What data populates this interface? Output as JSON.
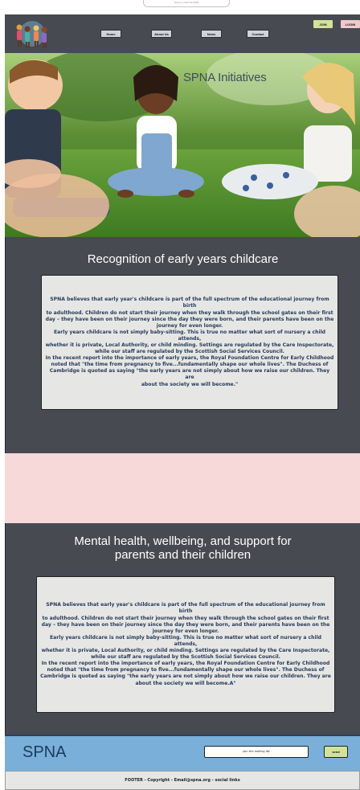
{
  "top_pill": "www.xx | April 22 2022",
  "nav": {
    "logo_icon": "children-logo-icon",
    "links": [
      "Home",
      "About Us",
      "News",
      "Contact"
    ],
    "join_label": "JOIN",
    "login_label": "LOGIN"
  },
  "hero": {
    "title": "SPNA Initiatives"
  },
  "section1": {
    "title": "Recognition of early years childcare",
    "body": "SPNA believes that early year's childcare is part of the full spectrum of the educational journey from birth\nto adulthood. Children do not start their journey when they walk through the school gates on their first\nday – they have been on their journey since the day they were born, and their parents have been on the\njourney for even longer.\nEarly years childcare is not simply baby-sitting. This is true no matter what sort of nursery a child attends,\nwhether it is private, Local Authority, or child minding. Settings are regulated by the Care Inspectorate,\nwhile our staff are regulated by the Scottish Social Services Council.\nIn the recent report into the importance of early years, the Royal Foundation Centre for Early Childhood\nnoted that \"the time from pregnancy to five...fundamentally shape our whole lives\". The Duchess of\nCambridge is quoted as saying \"the early years are not simply about how we raise our children. They are\nabout the society we will become.\""
  },
  "section2": {
    "title": "Mental health, wellbeing, and support for\nparents and their children",
    "body": "SPNA believes that early year's childcare is part of the full spectrum of the educational journey from birth\nto adulthood. Children do not start their journey when they walk through the school gates on their first\nday – they have been on their journey since the day they were born, and their parents have been on the\njourney for even longer.\nEarly years childcare is not simply baby-sitting. This is true no matter what sort of nursery a child attends,\nwhether it is private, Local Authority, or child minding. Settings are regulated by the Care Inspectorate,\nwhile our staff are regulated by the Scottish Social Services Council.\nIn the recent report into the importance of early years, the Royal Foundation Centre for Early Childhood\nnoted that \"the time from pregnancy to five...fundamentally shape our whole lives\". The Duchess of\nCambridge is quoted as saying \"the early years are not simply about how we raise our children. They are\nabout the society we will become.A\""
  },
  "subscribe": {
    "brand": "SPNA",
    "input_placeholder": "Join the mailing list",
    "send_label": "send"
  },
  "footer": {
    "text": "FOOTER - Copyright - Email@spna.org - social links"
  },
  "colors": {
    "nav_bg": "#474a51",
    "section_bg": "#474a51",
    "card_bg": "#e6e7e4",
    "pink_band": "#f7d9da",
    "subscribe_bg": "#79afd9",
    "join_btn": "#d3e29a",
    "login_btn": "#f2c9cb"
  }
}
